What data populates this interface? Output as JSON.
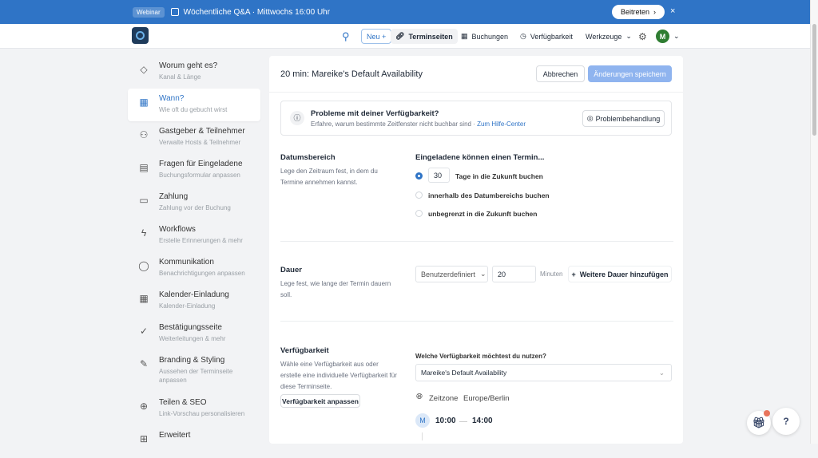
{
  "banner": {
    "badge": "Webinar",
    "title": "Wöchentliche Q&A · Mittwochs 16:00 Uhr",
    "join": "Beitreten",
    "join_chevron": "›",
    "close": "×"
  },
  "nav": {
    "new": "Neu +",
    "event_pages": "Terminseiten",
    "bookings": "Buchungen",
    "availability": "Verfügbarkeit",
    "tools": "Werkzeuge",
    "avatar": "M"
  },
  "sidebar": {
    "items": [
      {
        "title": "Worum geht es?",
        "sub": "Kanal & Länge",
        "icon": "◇"
      },
      {
        "title": "Wann?",
        "sub": "Wie oft du gebucht wirst",
        "icon": "▦"
      },
      {
        "title": "Gastgeber & Teilnehmer",
        "sub": "Verwalte Hosts & Teilnehmer",
        "icon": "⚇"
      },
      {
        "title": "Fragen für Eingeladene",
        "sub": "Buchungsformular anpassen",
        "icon": "▤"
      },
      {
        "title": "Zahlung",
        "sub": "Zahlung vor der Buchung",
        "icon": "▭"
      },
      {
        "title": "Workflows",
        "sub": "Erstelle Erinnerungen & mehr",
        "icon": "ϟ"
      },
      {
        "title": "Kommunikation",
        "sub": "Benachrichtigungen anpassen",
        "icon": "◯"
      },
      {
        "title": "Kalender-Einladung",
        "sub": "Kalender-Einladung",
        "icon": "▦"
      },
      {
        "title": "Bestätigungsseite",
        "sub": "Weiterleitungen & mehr",
        "icon": "✓"
      },
      {
        "title": "Branding & Styling",
        "sub": "Aussehen der Terminseite anpassen",
        "icon": "✎"
      },
      {
        "title": "Teilen & SEO",
        "sub": "Link-Vorschau personalisieren",
        "icon": "⊕"
      },
      {
        "title": "Erweitert",
        "sub": "",
        "icon": "⊞"
      }
    ]
  },
  "main": {
    "title": "20 min: Mareike's Default Availability",
    "cancel": "Abbrechen",
    "save": "Änderungen speichern",
    "alert": {
      "title": "Probleme mit deiner Verfügbarkeit?",
      "text": "Erfahre, warum bestimmte Zeitfenster nicht buchbar sind · ",
      "link": "Zum Hilfe-Center",
      "button": "Problembehandlung"
    },
    "date_range": {
      "title": "Datumsbereich",
      "desc": "Lege den Zeitraum fest, in dem du Termine annehmen kannst.",
      "label": "Eingeladene können einen Termin...",
      "days": "30",
      "opt1": "Tage in die Zukunft buchen",
      "opt2": "innerhalb des Datumbereichs buchen",
      "opt3": "unbegrenzt in die Zukunft buchen"
    },
    "duration": {
      "title": "Dauer",
      "desc": "Lege fest, wie lange der Termin dauern soll.",
      "type": "Benutzerdefiniert",
      "value": "20",
      "unit": "Minuten",
      "add": "Weitere Dauer hinzufügen"
    },
    "availability": {
      "title": "Verfügbarkeit",
      "desc": "Wähle eine Verfügbarkeit aus oder erstelle eine individuelle Verfügbarkeit für diese Terminseite.",
      "customize": "Verfügbarkeit anpassen",
      "question": "Welche Verfügbarkeit möchtest du nutzen?",
      "selected": "Mareike's Default Availability",
      "tz_label": "Zeitzone",
      "tz": "Europe/Berlin",
      "day": "M",
      "start": "10:00",
      "end": "14:00"
    }
  },
  "help": "?"
}
